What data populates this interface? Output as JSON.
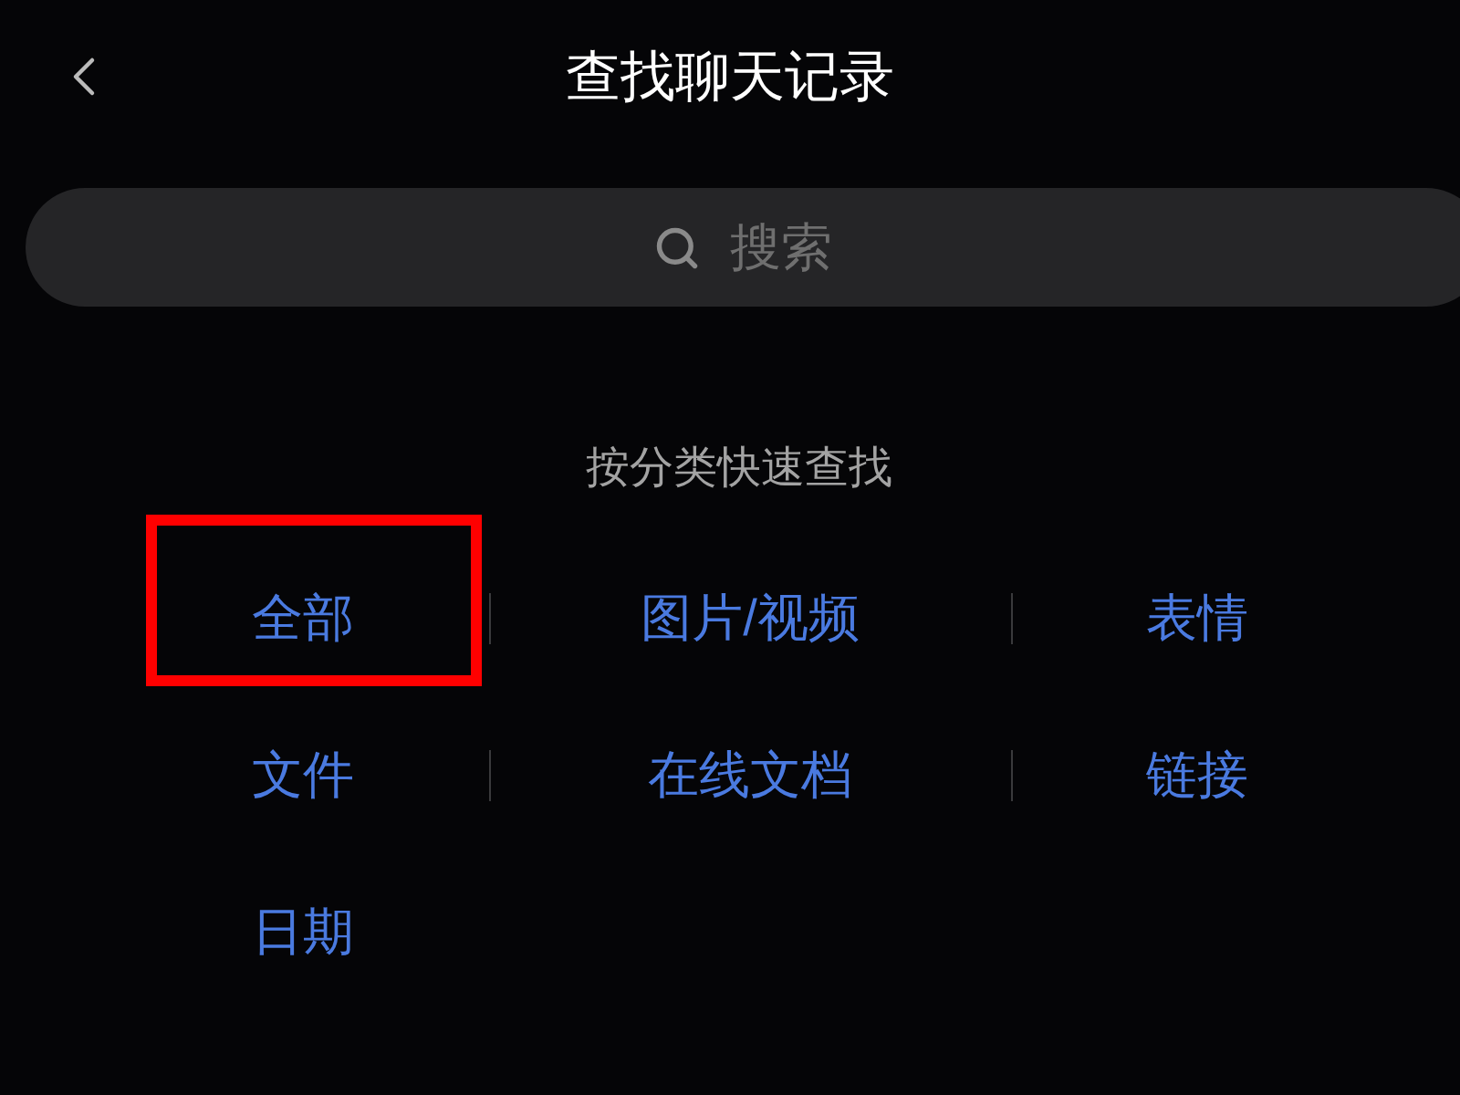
{
  "header": {
    "title": "查找聊天记录"
  },
  "search": {
    "placeholder": "搜索"
  },
  "category_section": {
    "title": "按分类快速查找",
    "items": [
      {
        "label": "全部",
        "highlighted": true
      },
      {
        "label": "图片/视频",
        "highlighted": false
      },
      {
        "label": "表情",
        "highlighted": false
      },
      {
        "label": "文件",
        "highlighted": false
      },
      {
        "label": "在线文档",
        "highlighted": false
      },
      {
        "label": "链接",
        "highlighted": false
      },
      {
        "label": "日期",
        "highlighted": false
      }
    ]
  }
}
